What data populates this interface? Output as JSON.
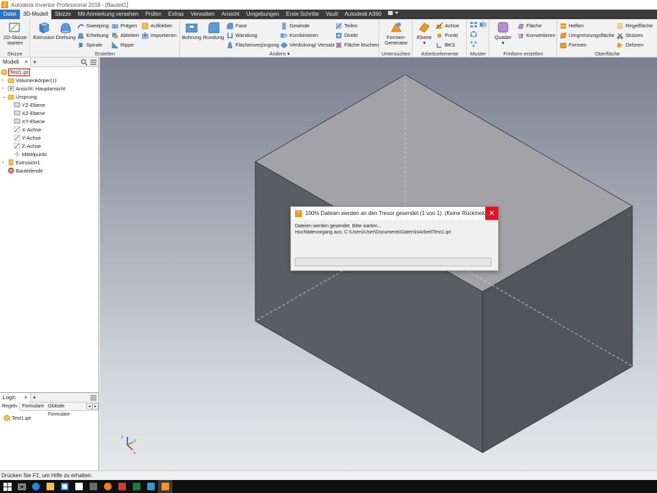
{
  "window": {
    "title": "Autodesk Inventor Professional 2018 - [Bauteil1]"
  },
  "menu": {
    "tabs": [
      "Datei",
      "3D-Modell",
      "Skizze",
      "Mit Anmerkung versehen",
      "Prüfen",
      "Extras",
      "Verwalten",
      "Ansicht",
      "Umgebungen",
      "Erste Schritte",
      "Vault",
      "Autodesk A360"
    ]
  },
  "ribbon": {
    "skizze": {
      "title": "Skizze",
      "start": "2D-Skizze starten"
    },
    "erstellen": {
      "title": "Erstellen",
      "extrusion": "Extrusion",
      "drehung": "Drehung",
      "sweeping": "Sweeping",
      "erhebung": "Erhebung",
      "spirale": "Spirale",
      "praegen": "Prägen",
      "ableiten": "Ableiten",
      "rippe": "Rippe",
      "aufkleber": "Aufkleber",
      "importieren": "Importieren"
    },
    "aendern": {
      "title": "Ändern",
      "bohrung": "Bohrung",
      "rundung": "Rundung",
      "fase": "Fase",
      "wandung": "Wandung",
      "flaechenverjuengung": "Flächenverjüngung",
      "gewinde": "Gewinde",
      "kombinieren": "Kombinieren",
      "verdickung": "Verdickung/ Versatz",
      "teilen": "Teilen",
      "direkt": "Direkt",
      "flaeche_loeschen": "Fläche löschen"
    },
    "untersuchen": {
      "title": "Untersuchen",
      "formen_generator": "Formen-Generator"
    },
    "arbeitselemente": {
      "title": "Arbeitselemente",
      "ebene": "Ebene",
      "achse": "Achse",
      "punkt": "Punkt",
      "bks": "BKS"
    },
    "muster": {
      "title": "Muster"
    },
    "freiform": {
      "title": "Freiform erstellen",
      "quader": "Quader",
      "flaeche": "Fläche",
      "konvertieren": "Konvertieren"
    },
    "oberflaeche": {
      "title": "Oberfläche",
      "heften": "Heften",
      "umgrenzungsflaeche": "Umgrenzungsfläche",
      "formen": "Formen",
      "regelflaeche": "Regelfläche",
      "stutzen": "Stutzen",
      "dehnen": "Dehnen"
    }
  },
  "browser": {
    "tab": "Modell",
    "items": [
      "Test1.ipt",
      "Volumenkörper(1)",
      "Ansicht: Hauptansicht",
      "Ursprung",
      "YZ-Ebene",
      "XZ-Ebene",
      "XY-Ebene",
      "X-Achse",
      "Y-Achse",
      "Z-Achse",
      "Mittelpunkt",
      "Extrusion1",
      "Bauteilende"
    ]
  },
  "logic": {
    "tab": "Logic",
    "subtabs": [
      "Regeln",
      "Formulare",
      "Globale Formulare"
    ],
    "item": "Test1.ipt"
  },
  "dialog": {
    "title": "100% Dateien werden an den Tresor gesendet (1 von 1). (Keine Rückmeldung)",
    "line1": "Dateien werden gesendet. Bitte warten...",
    "line2": "Hochladevorgang aus: C:\\Users\\User\\Documents\\Daten\\inArbeit\\Test1.ipt",
    "progress": 0.0
  },
  "status": {
    "text": "Drücken Sie F1, um Hilfe zu erhalten."
  },
  "colors": {
    "file_tab": "#2b73c6",
    "accent_orange": "#f39a1e",
    "close_red": "#e81123"
  }
}
